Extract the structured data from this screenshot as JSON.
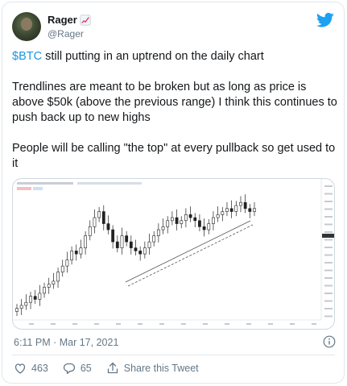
{
  "tweet": {
    "author_name": "Rager",
    "author_emoji": "chart-increasing-emoji",
    "handle": "@Rager",
    "cashtag": "$BTC",
    "line1_rest": " still putting in an uptrend on the daily chart",
    "para2": "Trendlines are meant to be broken but as long as price is above $50k (above the previous range) I think this continues to push back up to new highs",
    "para3": "People will be calling \"the top\" at every pullback so get used to it",
    "timestamp": "6:11 PM · Mar 17, 2021",
    "likes": "463",
    "replies": "65",
    "share_label": "Share this Tweet"
  },
  "colors": {
    "twitter_blue": "#1da1f2",
    "link_blue": "#1b95e0",
    "like_red": "#e0245e",
    "muted_gray": "#657786",
    "candle_dark": "#222222",
    "trendline": "#444444"
  },
  "icons": {
    "brand": "twitter-bird-icon",
    "info": "info-icon",
    "like": "heart-icon",
    "reply": "reply-bubble-icon",
    "share": "share-upload-icon"
  },
  "chart_data": {
    "type": "candlestick",
    "description_series": "BTC daily candles rising with an ascending dashed trendline channel",
    "closes": [
      28,
      29,
      30,
      32,
      31,
      33,
      35,
      36,
      37,
      40,
      42,
      44,
      47,
      46,
      48,
      52,
      55,
      58,
      60,
      56,
      54,
      50,
      48,
      52,
      50,
      48,
      47,
      46,
      48,
      50,
      52,
      54,
      55,
      57,
      58,
      56,
      57,
      59,
      58,
      57,
      55,
      54,
      56,
      58,
      59,
      60,
      61,
      60,
      62,
      63,
      61,
      60,
      61
    ]
  }
}
